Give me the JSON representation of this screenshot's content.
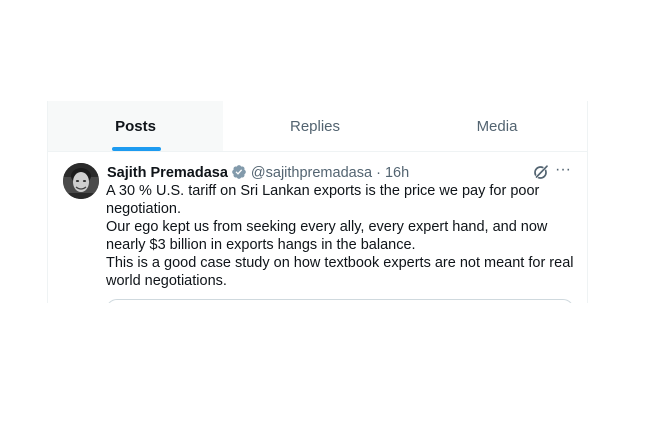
{
  "tabs": [
    {
      "label": "Posts",
      "active": true
    },
    {
      "label": "Replies",
      "active": false
    },
    {
      "label": "Media",
      "active": false
    }
  ],
  "post": {
    "author_name": "Sajith Premadasa",
    "handle": "@sajithpremadasa",
    "separator": "·",
    "time": "16h",
    "verified_icon": "verified-badge-icon",
    "more_label": "···",
    "lines": [
      "A 30 % U.S. tariff on Sri Lankan exports is the price we pay for poor negotiation.",
      "Our ego kept us from seeking every ally, every expert hand, and now nearly $3 billion in exports hangs in the balance.",
      "This is a good case study on how textbook experts are not meant for real world negotiations."
    ]
  },
  "colors": {
    "accent": "#1d9bf0",
    "text_primary": "#0f1419",
    "text_secondary": "#536471",
    "border": "#eff3f4",
    "verified_badge": "#829aab"
  }
}
